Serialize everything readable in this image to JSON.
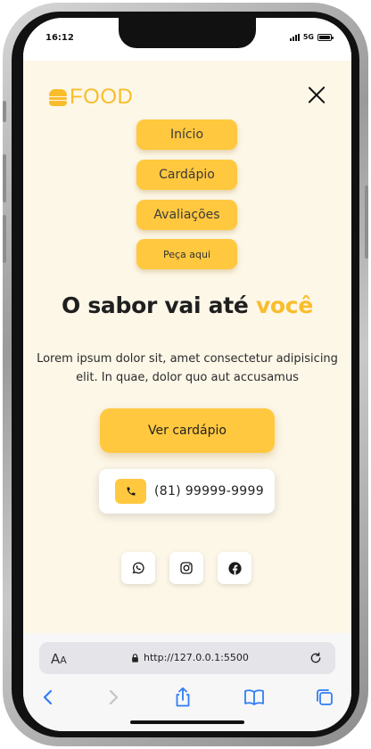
{
  "status_bar": {
    "time": "16:12",
    "network": "5G"
  },
  "header": {
    "logo_text": "FOOD",
    "logo_icon": "burger-icon",
    "close_icon": "close-icon"
  },
  "nav": {
    "items": [
      {
        "label": "Início"
      },
      {
        "label": "Cardápio"
      },
      {
        "label": "Avaliações"
      },
      {
        "label": "Peça aqui"
      }
    ]
  },
  "hero": {
    "title_main": "O sabor vai até ",
    "title_accent": "você",
    "description": "Lorem ipsum dolor sit, amet consectetur adipisicing elit. In quae, dolor quo aut accusamus",
    "cta_label": "Ver cardápio"
  },
  "contact": {
    "icon": "phone-icon",
    "phone": "(81) 99999-9999"
  },
  "socials": [
    {
      "icon": "whatsapp-icon"
    },
    {
      "icon": "instagram-icon"
    },
    {
      "icon": "facebook-icon"
    }
  ],
  "browser": {
    "text_size_label_big": "A",
    "text_size_label_small": "A",
    "url": "http://127.0.0.1:5500"
  },
  "colors": {
    "accent": "#f9bd2c",
    "button": "#ffc83f",
    "background": "#fdf7e8",
    "text": "#1f1f1f"
  }
}
